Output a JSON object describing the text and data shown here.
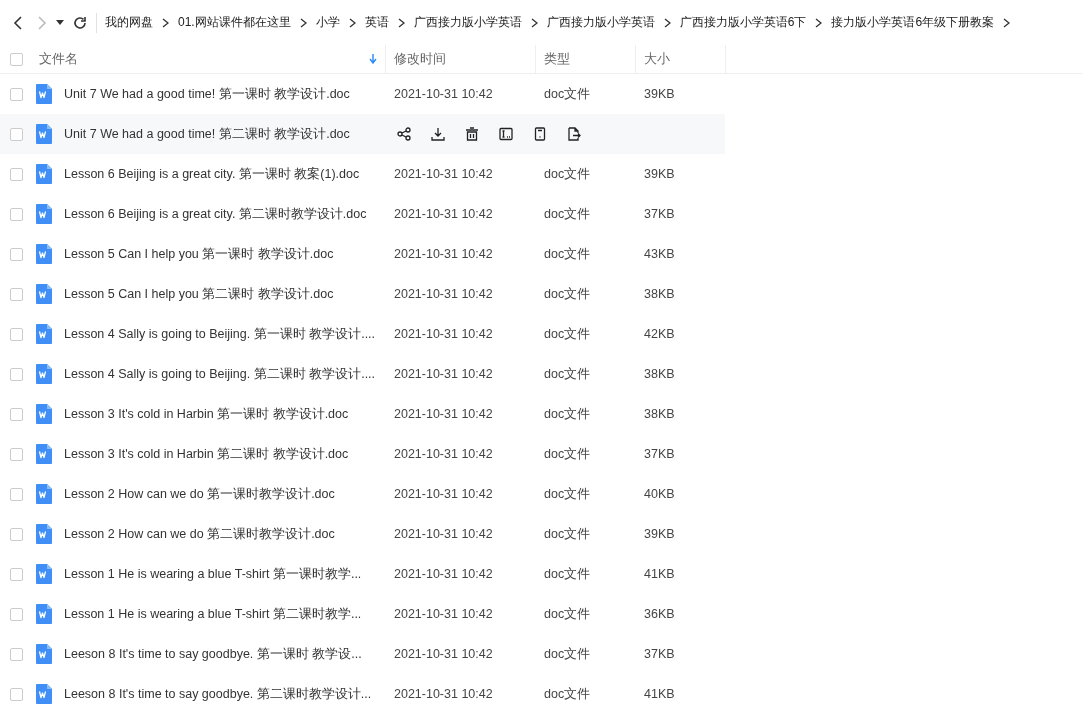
{
  "select_all_checked": false,
  "breadcrumb": [
    "我的网盘",
    "01.网站课件都在这里",
    "小学",
    "英语",
    "广西接力版小学英语",
    "广西接力版小学英语",
    "广西接力版小学英语6下",
    "接力版小学英语6年级下册教案"
  ],
  "table": {
    "columns": [
      {
        "label": "文件名",
        "sorted": true
      },
      {
        "label": "修改时间",
        "sorted": false
      },
      {
        "label": "类型",
        "sorted": false
      },
      {
        "label": "大小",
        "sorted": false
      }
    ],
    "rows": [
      {
        "name": "Unit 7 We had a good time! 第一课时  教学设计.doc",
        "date": "2021-10-31 10:42",
        "type": "doc文件",
        "size": "39KB",
        "hovered": false
      },
      {
        "name": "Unit 7 We had a good time! 第二课时 教学设计.doc",
        "hovered": true
      },
      {
        "name": "Lesson 6 Beijing is a great city. 第一课时 教案(1).doc",
        "date": "2021-10-31 10:42",
        "type": "doc文件",
        "size": "39KB",
        "hovered": false
      },
      {
        "name": "Lesson 6 Beijing is a great city. 第二课时教学设计.doc",
        "date": "2021-10-31 10:42",
        "type": "doc文件",
        "size": "37KB",
        "hovered": false
      },
      {
        "name": "Lesson 5 Can I help you 第一课时 教学设计.doc",
        "date": "2021-10-31 10:42",
        "type": "doc文件",
        "size": "43KB",
        "hovered": false
      },
      {
        "name": "Lesson 5 Can I help you 第二课时 教学设计.doc",
        "date": "2021-10-31 10:42",
        "type": "doc文件",
        "size": "38KB",
        "hovered": false
      },
      {
        "name": "Lesson 4 Sally is going to Beijing. 第一课时 教学设计....",
        "date": "2021-10-31 10:42",
        "type": "doc文件",
        "size": "42KB",
        "hovered": false
      },
      {
        "name": "Lesson 4 Sally is going to Beijing. 第二课时 教学设计....",
        "date": "2021-10-31 10:42",
        "type": "doc文件",
        "size": "38KB",
        "hovered": false
      },
      {
        "name": "Lesson 3 It's cold in Harbin 第一课时  教学设计.doc",
        "date": "2021-10-31 10:42",
        "type": "doc文件",
        "size": "38KB",
        "hovered": false
      },
      {
        "name": "Lesson 3 It's cold in Harbin 第二课时 教学设计.doc",
        "date": "2021-10-31 10:42",
        "type": "doc文件",
        "size": "37KB",
        "hovered": false
      },
      {
        "name": "Lesson 2 How can we do 第一课时教学设计.doc",
        "date": "2021-10-31 10:42",
        "type": "doc文件",
        "size": "40KB",
        "hovered": false
      },
      {
        "name": "Lesson 2 How can we do 第二课时教学设计.doc",
        "date": "2021-10-31 10:42",
        "type": "doc文件",
        "size": "39KB",
        "hovered": false
      },
      {
        "name": "Lesson 1 He is wearing a blue T-shirt  第一课时教学...",
        "date": "2021-10-31 10:42",
        "type": "doc文件",
        "size": "41KB",
        "hovered": false
      },
      {
        "name": "Lesson 1 He is wearing a blue T-shirt  第二课时教学...",
        "date": "2021-10-31 10:42",
        "type": "doc文件",
        "size": "36KB",
        "hovered": false
      },
      {
        "name": "Leeson 8 It's time to say goodbye. 第一课时 教学设...",
        "date": "2021-10-31 10:42",
        "type": "doc文件",
        "size": "37KB",
        "hovered": false
      },
      {
        "name": "Leeson 8 It's time to say goodbye. 第二课时教学设计...",
        "date": "2021-10-31 10:42",
        "type": "doc文件",
        "size": "41KB",
        "hovered": false
      }
    ]
  }
}
